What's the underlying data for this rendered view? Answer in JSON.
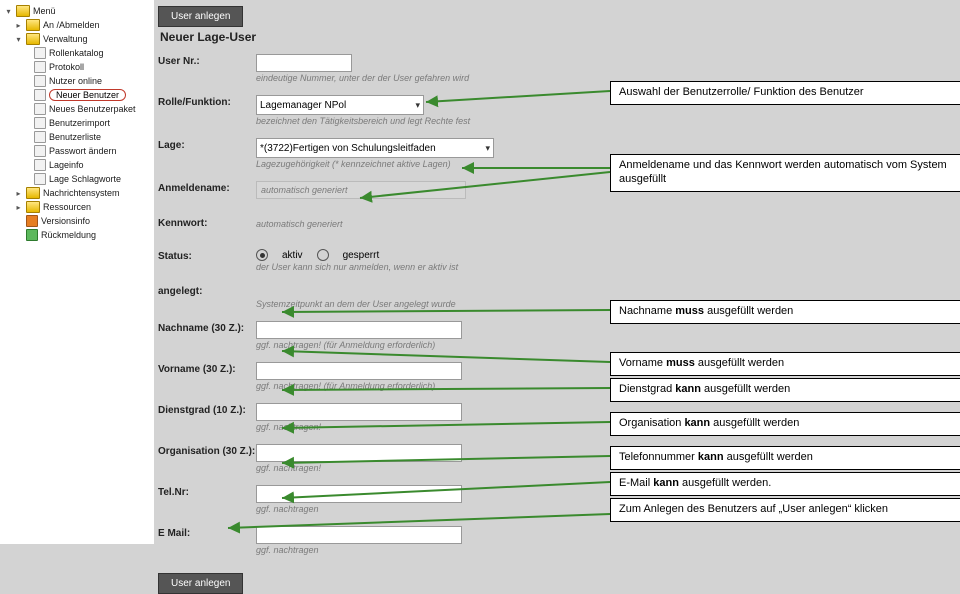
{
  "sidebar": {
    "root": "Menü",
    "items": [
      {
        "label": "An /Abmelden"
      },
      {
        "label": "Verwaltung"
      },
      {
        "label": "Rollenkatalog",
        "sub": true
      },
      {
        "label": "Protokoll",
        "sub": true
      },
      {
        "label": "Nutzer online",
        "sub": true
      },
      {
        "label": "Neuer Benutzer",
        "sub": true,
        "selected": true
      },
      {
        "label": "Neues Benutzerpaket",
        "sub": true
      },
      {
        "label": "Benutzerimport",
        "sub": true
      },
      {
        "label": "Benutzerliste",
        "sub": true
      },
      {
        "label": "Passwort ändern",
        "sub": true
      },
      {
        "label": "Lageinfo",
        "sub": true
      },
      {
        "label": "Lage Schlagworte",
        "sub": true
      },
      {
        "label": "Nachrichtensystem"
      },
      {
        "label": "Ressourcen"
      },
      {
        "label": "Versionsinfo"
      },
      {
        "label": "Rückmeldung"
      }
    ]
  },
  "top_button": "User anlegen",
  "form": {
    "title": "Neuer Lage-User",
    "user_nr": {
      "label": "User Nr.:",
      "hint": "eindeutige Nummer, unter der der User gefahren wird"
    },
    "rolle": {
      "label": "Rolle/Funktion:",
      "value": "Lagemanager NPol",
      "hint": "bezeichnet den Tätigkeitsbereich und legt Rechte fest"
    },
    "lage": {
      "label": "Lage:",
      "value": "*(3722)Fertigen von Schulungsleitfaden",
      "hint": "Lagezugehörigkeit (* kennzeichnet aktive Lagen)"
    },
    "anmeldename": {
      "label": "Anmeldename:",
      "gen": "automatisch generiert"
    },
    "kennwort": {
      "label": "Kennwort:",
      "gen": "automatisch generiert"
    },
    "status": {
      "label": "Status:",
      "opt1": "aktiv",
      "opt2": "gesperrt",
      "hint": "der User kann sich nur anmelden, wenn er aktiv ist"
    },
    "angelegt": {
      "label": "angelegt:",
      "hint": "Systemzeitpunkt an dem der User angelegt wurde"
    },
    "nachname": {
      "label": "Nachname (30 Z.):",
      "hint": "ggf. nachtragen! (für Anmeldung erforderlich)"
    },
    "vorname": {
      "label": "Vorname (30 Z.):",
      "hint": "ggf. nachtragen! (für Anmeldung erforderlich)"
    },
    "dienstgrad": {
      "label": "Dienstgrad (10 Z.):",
      "hint": "ggf. nachtragen!"
    },
    "organisation": {
      "label": "Organisation (30 Z.):",
      "hint": "ggf. nachtragen!"
    },
    "telnr": {
      "label": "Tel.Nr:",
      "hint": "ggf. nachtragen"
    },
    "email": {
      "label": "E Mail:",
      "hint": "ggf. nachtragen"
    },
    "submit": "User anlegen"
  },
  "callouts": {
    "c1": "Auswahl der Benutzerrolle/ Funktion des Benutzer",
    "c2": "Anmeldename und das  Kennwort werden automatisch vom System ausgefüllt",
    "c3_a": "Nachname ",
    "c3_b": "muss",
    "c3_c": " ausgefüllt werden",
    "c4_a": "Vorname ",
    "c4_b": "muss",
    "c4_c": " ausgefüllt werden",
    "c5_a": "Dienstgrad ",
    "c5_b": "kann",
    "c5_c": " ausgefüllt werden",
    "c6_a": "Organisation ",
    "c6_b": "kann",
    "c6_c": " ausgefüllt werden",
    "c7_a": "Telefonnummer ",
    "c7_b": "kann",
    "c7_c": " ausgefüllt werden",
    "c8_a": "E-Mail ",
    "c8_b": "kann",
    "c8_c": " ausgefüllt werden.",
    "c9": "Zum Anlegen des Benutzers auf „User anlegen“ klicken"
  }
}
